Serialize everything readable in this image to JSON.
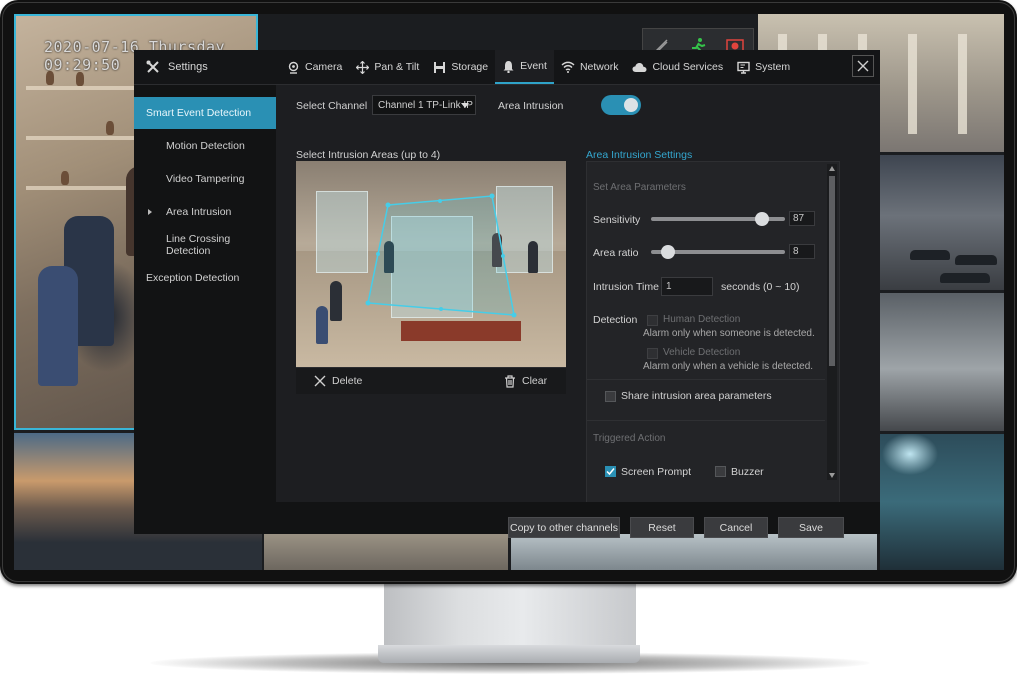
{
  "camera_view": {
    "timestamp": "2020-07-16 Thursday 09:29:50"
  },
  "dialog": {
    "title": "Settings",
    "tabs": [
      {
        "label": "Camera",
        "icon": "camera-icon"
      },
      {
        "label": "Pan & Tilt",
        "icon": "pan-tilt-icon"
      },
      {
        "label": "Storage",
        "icon": "storage-icon"
      },
      {
        "label": "Event",
        "icon": "bell-icon",
        "active": true
      },
      {
        "label": "Network",
        "icon": "wifi-icon"
      },
      {
        "label": "Cloud Services",
        "icon": "cloud-icon"
      },
      {
        "label": "System",
        "icon": "monitor-icon"
      }
    ],
    "sidebar": [
      {
        "label": "Smart Event Detection",
        "active": true
      },
      {
        "label": "Motion Detection"
      },
      {
        "label": "Video Tampering"
      },
      {
        "label": "Area Intrusion",
        "current": true
      },
      {
        "label": "Line Crossing Detection"
      },
      {
        "label": "Exception Detection"
      }
    ],
    "select_channel_label": "Select Channel",
    "channel_value": "Channel 1 TP-Link IP",
    "area_intrusion_label": "Area Intrusion",
    "area_intrusion_enabled": true,
    "select_areas_label": "Select Intrusion Areas (up to 4)",
    "delete_label": "Delete",
    "clear_label": "Clear",
    "settings_heading": "Area Intrusion Settings",
    "set_area_params": "Set Area Parameters",
    "sensitivity_label": "Sensitivity",
    "sensitivity_value": "87",
    "sensitivity_max": 100,
    "area_ratio_label": "Area ratio",
    "area_ratio_value": "8",
    "area_ratio_max": 100,
    "intrusion_time_label": "Intrusion Time",
    "intrusion_time_value": "1",
    "intrusion_time_unit": "seconds (0 ~ 10)",
    "detection_label": "Detection",
    "human_detection_label": "Human Detection",
    "human_detection_note": "Alarm only when someone is detected.",
    "vehicle_detection_label": "Vehicle Detection",
    "vehicle_detection_note": "Alarm only when a vehicle is detected.",
    "share_params_label": "Share intrusion area parameters",
    "triggered_action_label": "Triggered Action",
    "screen_prompt_label": "Screen Prompt",
    "buzzer_label": "Buzzer",
    "buttons": {
      "copy": "Copy to other channels",
      "reset": "Reset",
      "cancel": "Cancel",
      "save": "Save"
    },
    "accent_color": "#2a90b4"
  }
}
